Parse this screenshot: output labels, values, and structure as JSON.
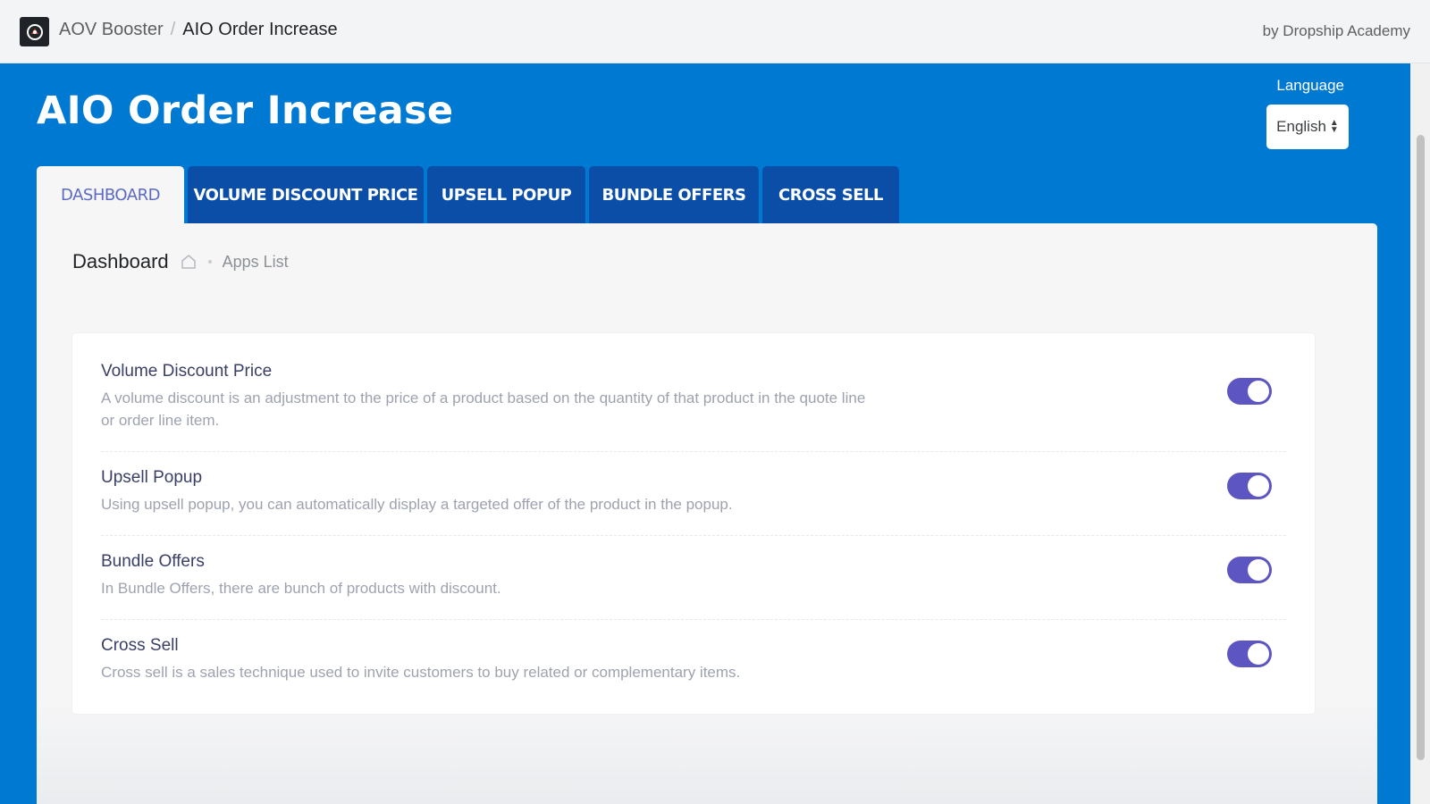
{
  "topbar": {
    "breadcrumb_parent": "AOV Booster",
    "breadcrumb_separator": "/",
    "breadcrumb_current": "AIO Order Increase",
    "by_line": "by Dropship Academy"
  },
  "header": {
    "title": "AIO Order Increase",
    "language_label": "Language",
    "language_value": "English"
  },
  "tabs": [
    {
      "label": "DASHBOARD",
      "active": true
    },
    {
      "label": "VOLUME DISCOUNT PRICE",
      "active": false
    },
    {
      "label": "UPSELL POPUP",
      "active": false
    },
    {
      "label": "BUNDLE OFFERS",
      "active": false
    },
    {
      "label": "CROSS SELL",
      "active": false
    }
  ],
  "panel": {
    "title": "Dashboard",
    "breadcrumb": "Apps List"
  },
  "apps": [
    {
      "title": "Volume Discount Price",
      "description": "A volume discount is an adjustment to the price of a product based on the quantity of that product in the quote line or order line item.",
      "enabled": true
    },
    {
      "title": "Upsell Popup",
      "description": "Using upsell popup, you can automatically display a targeted offer of the product in the popup.",
      "enabled": true
    },
    {
      "title": "Bundle Offers",
      "description": "In Bundle Offers, there are bunch of products with discount.",
      "enabled": true
    },
    {
      "title": "Cross Sell",
      "description": "Cross sell is a sales technique used to invite customers to buy related or complementary items.",
      "enabled": true
    }
  ],
  "colors": {
    "primary_blue": "#0079d3",
    "tab_blue": "#0a4ea8",
    "toggle_on": "#5c55c2"
  }
}
